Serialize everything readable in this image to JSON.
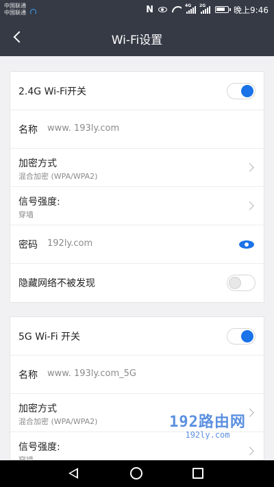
{
  "status_bar": {
    "carrier_1": "中国联通",
    "carrier_2": "中国联通",
    "network_tag_1": "4G",
    "network_tag_2": "2G",
    "time": "晚上9:46",
    "icons": [
      "nfc-icon",
      "eye-comfort-icon",
      "wifi-signal-icon",
      "cell-signal-icon",
      "battery-icon"
    ]
  },
  "header": {
    "title": "Wi-Fi设置",
    "back_icon": "chevron-left-icon"
  },
  "wifi_24g": {
    "switch_label": "2.4G Wi-Fi开关",
    "switch_on": true,
    "name_label": "名称",
    "name_value": "www. 193ly.com",
    "encryption_label": "加密方式",
    "encryption_value": "混合加密 (WPA/WPA2)",
    "signal_label": "信号强度:",
    "signal_value": "穿墙",
    "password_label": "密码",
    "password_value": "192ly.com",
    "hide_label": "隐藏网络不被发现",
    "hide_on": false
  },
  "wifi_5g": {
    "switch_label": "5G Wi-Fi 开关",
    "switch_on": true,
    "name_label": "名称",
    "name_value": "www. 193ly.com_5G",
    "encryption_label": "加密方式",
    "encryption_value": "混合加密 (WPA/WPA2)",
    "signal_label": "信号强度:",
    "signal_value": "穿墙"
  },
  "watermark": {
    "main": "192路由网",
    "sub": "192ly.com"
  },
  "colors": {
    "header_bg": "#353a45",
    "accent": "#1a73e8",
    "page_bg": "#f1f1f3"
  }
}
